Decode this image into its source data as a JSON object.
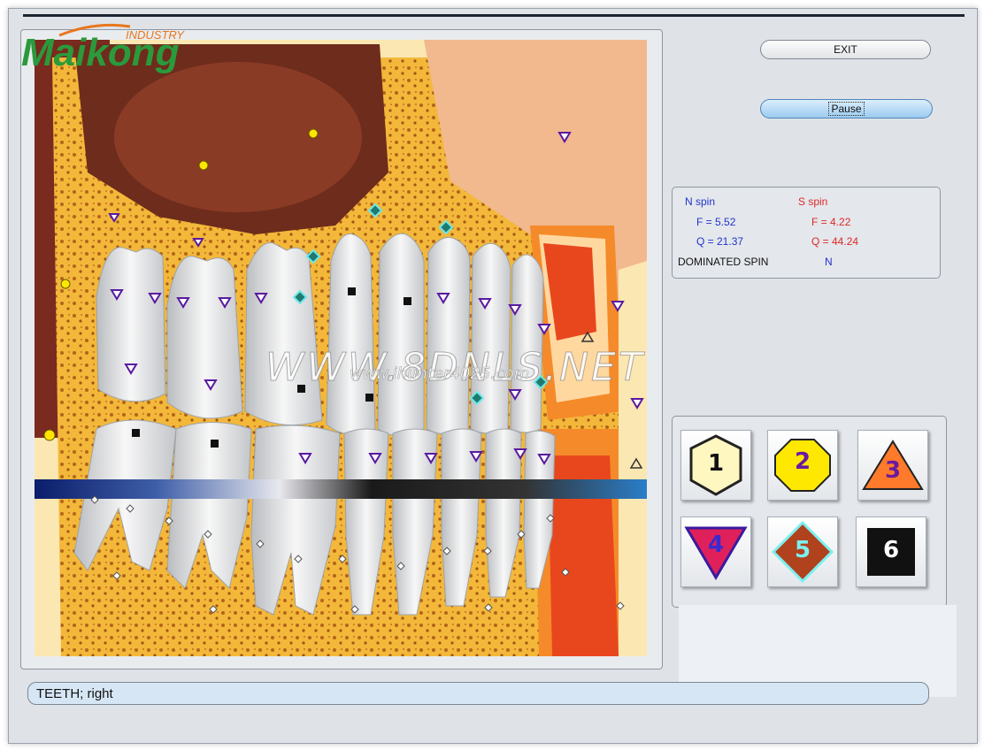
{
  "logo": {
    "industry": "INDUSTRY",
    "brand": "Maikong"
  },
  "watermark": {
    "main": "WWW.8DNLS.NET",
    "sub": "www.ihunter4025.com"
  },
  "controls": {
    "exit_label": "EXIT",
    "pause_label": "Pause"
  },
  "spin": {
    "n_label": "N spin",
    "s_label": "S spin",
    "n_f": "F =  5.52",
    "n_q": "Q = 21.37",
    "s_f": "F =  4.22",
    "s_q": "Q = 44.24",
    "dominated_label": "DOMINATED SPIN",
    "dominated_value": "N"
  },
  "markers": [
    {
      "label": "1",
      "shape": "hexagon",
      "fill": "#fff7c0"
    },
    {
      "label": "2",
      "shape": "octagon",
      "fill": "#ffe800"
    },
    {
      "label": "3",
      "shape": "triangle-up",
      "fill": "#ff7a2a"
    },
    {
      "label": "4",
      "shape": "triangle-down",
      "fill": "#e0205a"
    },
    {
      "label": "5",
      "shape": "diamond",
      "fill": "#b0421e"
    },
    {
      "label": "6",
      "shape": "square",
      "fill": "#111111"
    }
  ],
  "status": {
    "text": "TEETH; right"
  },
  "colors": {
    "status_bg": "#d6e6f5",
    "pause_bg": "#9ccbf0",
    "n_spin": "#2233cc",
    "s_spin": "#dd2a2a"
  }
}
